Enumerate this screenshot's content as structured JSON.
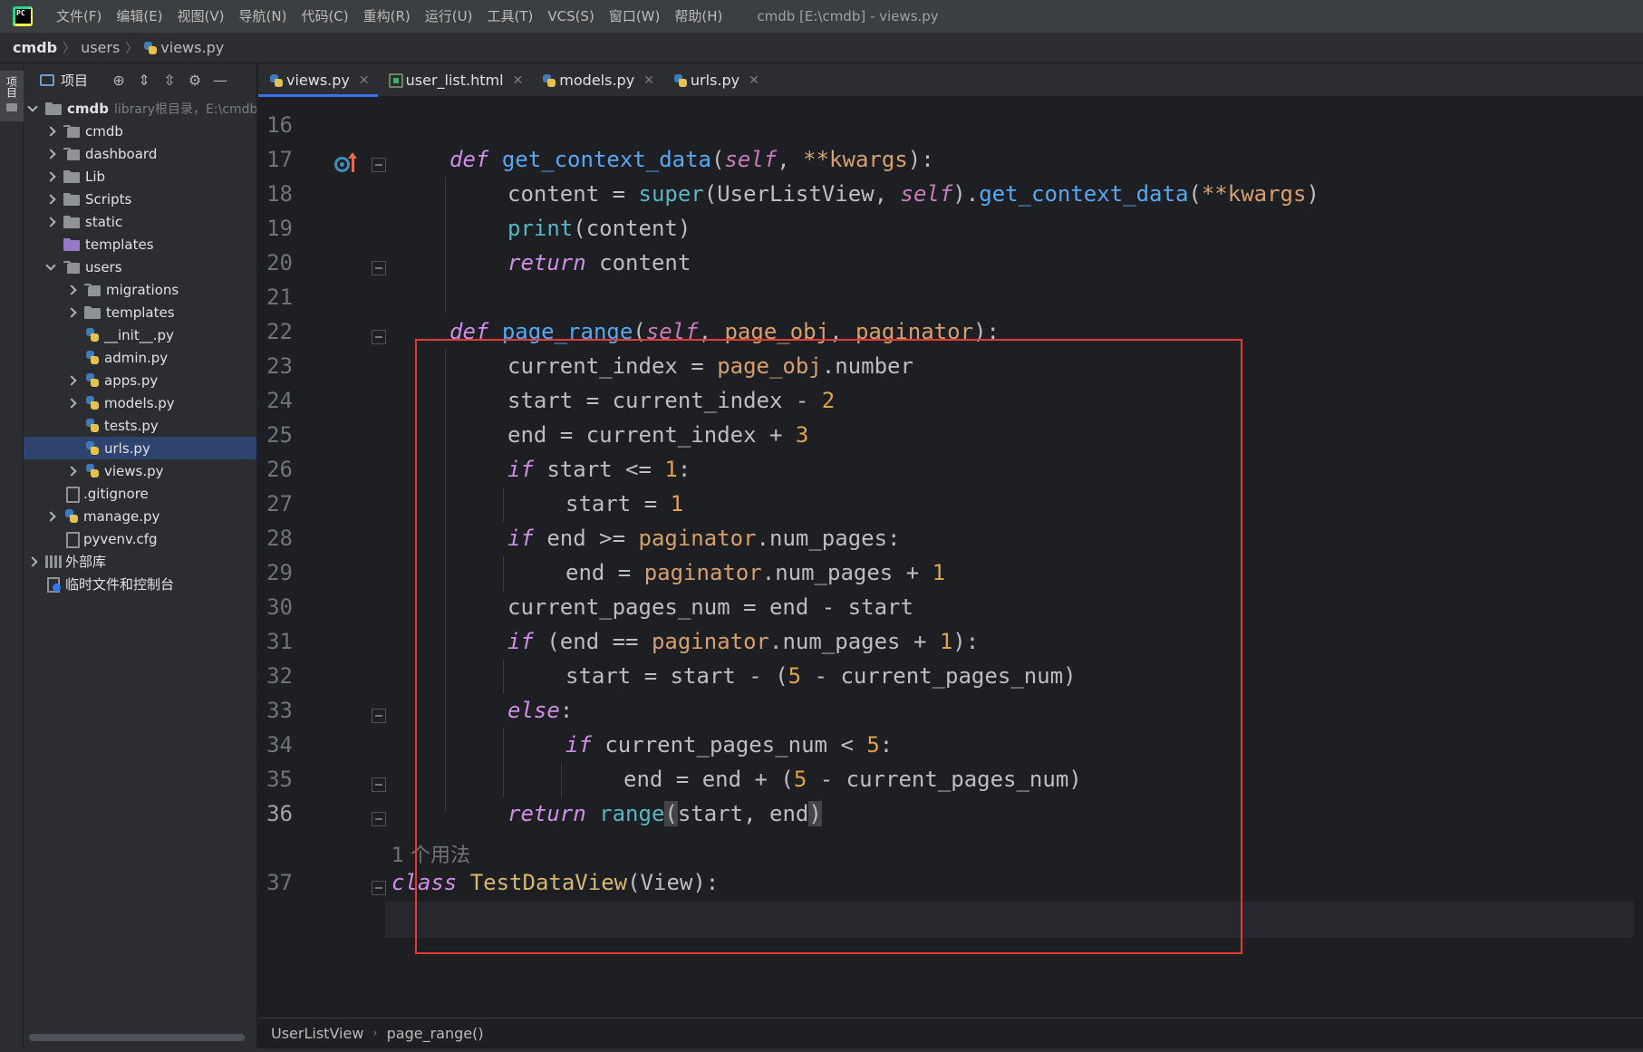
{
  "menubar": {
    "items": [
      "文件(F)",
      "编辑(E)",
      "视图(V)",
      "导航(N)",
      "代码(C)",
      "重构(R)",
      "运行(U)",
      "工具(T)",
      "VCS(S)",
      "窗口(W)",
      "帮助(H)"
    ],
    "window_title": "cmdb [E:\\cmdb] - views.py"
  },
  "breadcrumb": {
    "root": "cmdb",
    "folder": "users",
    "file": "views.py"
  },
  "toolstrip": {
    "project_label": "项目"
  },
  "project_panel": {
    "title": "项目",
    "tree": [
      {
        "label": "cmdb",
        "note": "library根目录，E:\\cmdb"
      },
      {
        "label": "cmdb"
      },
      {
        "label": "dashboard"
      },
      {
        "label": "Lib"
      },
      {
        "label": "Scripts"
      },
      {
        "label": "static"
      },
      {
        "label": "templates"
      },
      {
        "label": "users"
      },
      {
        "label": "migrations"
      },
      {
        "label": "templates"
      },
      {
        "label": "__init__.py"
      },
      {
        "label": "admin.py"
      },
      {
        "label": "apps.py"
      },
      {
        "label": "models.py"
      },
      {
        "label": "tests.py"
      },
      {
        "label": "urls.py"
      },
      {
        "label": "views.py"
      },
      {
        "label": ".gitignore"
      },
      {
        "label": "manage.py"
      },
      {
        "label": "pyvenv.cfg"
      },
      {
        "label": "外部库"
      },
      {
        "label": "临时文件和控制台"
      }
    ]
  },
  "editor_tabs": [
    {
      "label": "views.py",
      "active": true
    },
    {
      "label": "user_list.html",
      "active": false
    },
    {
      "label": "models.py",
      "active": false
    },
    {
      "label": "urls.py",
      "active": false
    }
  ],
  "editor": {
    "line_numbers": [
      "16",
      "17",
      "18",
      "19",
      "20",
      "21",
      "22",
      "23",
      "24",
      "25",
      "26",
      "27",
      "28",
      "29",
      "30",
      "31",
      "32",
      "33",
      "34",
      "35",
      "36",
      "37"
    ],
    "current_line": "36",
    "usage_hint": "1 个用法",
    "code": {
      "l17": "get_context_data",
      "l18_a": "content = ",
      "l18_b": "super",
      "l18_c": "UserListView",
      "l18_d": "get_context_data",
      "l19": "print",
      "l20": "content",
      "l22_fn": "page_range",
      "l22_p1": "page_obj",
      "l22_p2": "paginator",
      "l23_a": "current_index = ",
      "l23_b": "page_obj",
      "l23_c": ".number",
      "l24": "start = current_index - ",
      "l24_n": "2",
      "l25": "end = current_index + ",
      "l25_n": "3",
      "l26": " start <= ",
      "l26_n": "1",
      "l27": "start = ",
      "l27_n": "1",
      "l28_a": " end >= ",
      "l28_b": "paginator",
      "l28_c": ".num_pages:",
      "l29_a": "end = ",
      "l29_b": "paginator",
      "l29_c": ".num_pages + ",
      "l29_n": "1",
      "l30": "current_pages_num = end - start",
      "l31_a": " (end == ",
      "l31_b": "paginator",
      "l31_c": ".num_pages + ",
      "l31_n": "1",
      "l32_a": "start = start - (",
      "l32_n": "5",
      "l32_b": " - current_pages_num)",
      "l33": "else",
      "l34_a": " current_pages_num < ",
      "l34_n": "5",
      "l35_a": "end = end + (",
      "l35_n": "5",
      "l35_b": " - current_pages_num)",
      "l36_fn": "range",
      "l36_args": "start, end",
      "l37_cls": "TestDataView",
      "l37_base": "View"
    }
  },
  "editor_breadcrumb": {
    "class": "UserListView",
    "method": "page_range()"
  },
  "colors": {
    "accent": "#3574f0",
    "highlight_box": "#e53935",
    "selected_row": "#2e436e"
  }
}
